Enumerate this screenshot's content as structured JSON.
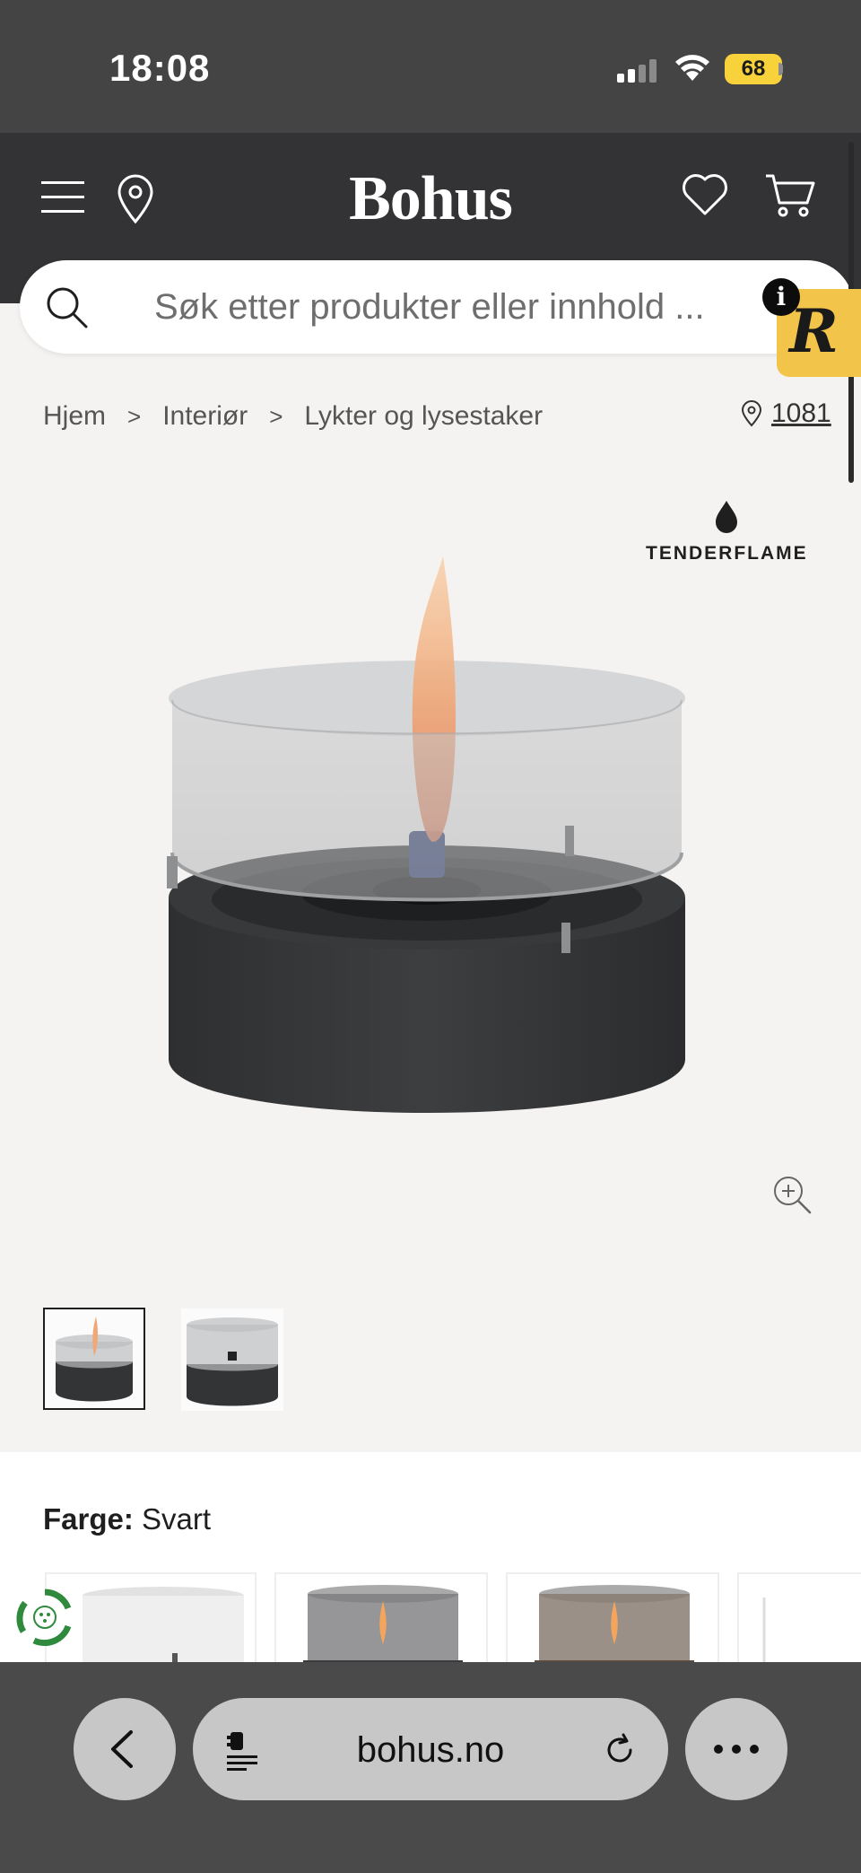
{
  "status_bar": {
    "time": "18:08",
    "battery": "68"
  },
  "header": {
    "logo": "Bohus"
  },
  "search": {
    "placeholder": "Søk etter produkter eller innhold ..."
  },
  "badges": {
    "info": "i",
    "r_widget": "R"
  },
  "breadcrumb": {
    "items": [
      "Hjem",
      "Interiør",
      "Lykter og lysestaker"
    ],
    "separator": ">",
    "store": "1081"
  },
  "brand": {
    "name": "TENDERFLAME"
  },
  "product": {
    "color_label": "Farge:",
    "color_value": "Svart"
  },
  "browser": {
    "url": "bohus.no"
  },
  "colors": {
    "status_bar": "#444444",
    "header": "#333335",
    "page_bg": "#f5f3f1",
    "battery": "#f7d23a",
    "r_widget": "#f3c44a",
    "recycle": "#2f8a3d"
  }
}
